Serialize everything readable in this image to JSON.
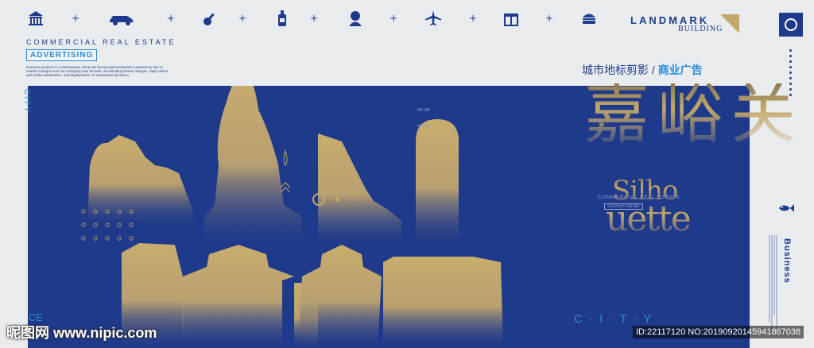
{
  "header": {
    "icons": [
      "museum-icon",
      "car-icon",
      "guitar-icon",
      "bottle-icon",
      "portrait-icon",
      "airplane-icon",
      "gift-icon",
      "burger-icon"
    ],
    "brand_title": "LANDMARK",
    "brand_subtitle": "BUILDING",
    "accent": "#c4a86a",
    "brand_color": "#1f3a8a"
  },
  "left": {
    "commercial": "COMMERCIAL REAL ESTATE",
    "advertising": "ADVERTISING",
    "para": "business projects in contemporary china are facing unprecedented competency due to market changes such as emerging new formats, accelerating brand changes, rapid online and online penetration, and digitalization of operational decisions",
    "city_vertical": "CITY"
  },
  "right": {
    "cn_title_a": "城市地标剪影 / ",
    "cn_title_b": "商业广告",
    "big_cn": "嘉峪关",
    "silho": "Silho",
    "uette": "uette",
    "panel_commercial": "COMMERCIAL REAL ESTATE",
    "panel_advertising": "ADVERTISING",
    "business": "Business",
    "city_spaced": "C · I · T · Y"
  },
  "panel": {
    "small_num_a": "88 +88",
    "small_num_b": "88 +88",
    "ce": "CE",
    "bg_color": "#1f3a8a"
  },
  "watermark": {
    "site": "昵图网 www.nipic.com",
    "id_text": "ID:22117120 NO:20190920145941867038"
  }
}
